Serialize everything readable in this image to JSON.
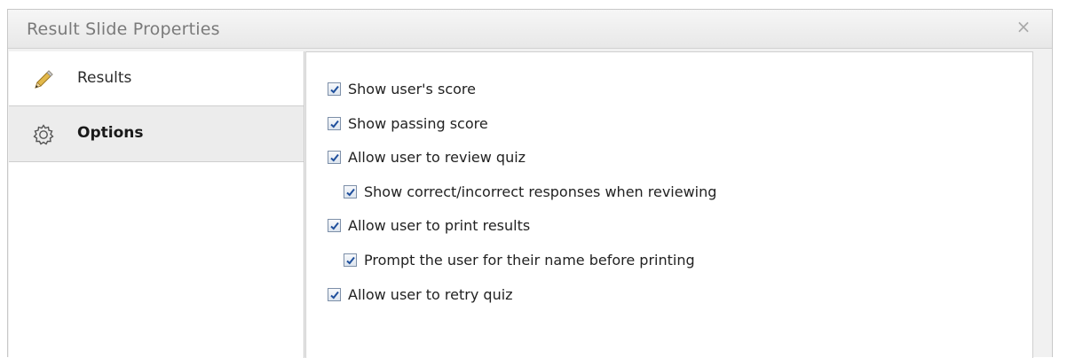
{
  "dialog": {
    "title": "Result Slide Properties",
    "close_glyph": "×"
  },
  "sidebar": {
    "items": [
      {
        "label": "Results",
        "icon": "pencil-icon",
        "selected": false
      },
      {
        "label": "Options",
        "icon": "gear-icon",
        "selected": true
      }
    ]
  },
  "options": [
    {
      "label": "Show user's score",
      "checked": true,
      "indent": 0
    },
    {
      "label": "Show passing score",
      "checked": true,
      "indent": 0
    },
    {
      "label": "Allow user to review quiz",
      "checked": true,
      "indent": 0
    },
    {
      "label": "Show correct/incorrect responses when reviewing",
      "checked": true,
      "indent": 1
    },
    {
      "label": "Allow user to print results",
      "checked": true,
      "indent": 0
    },
    {
      "label": "Prompt the user for their name before printing",
      "checked": true,
      "indent": 1
    },
    {
      "label": "Allow user to retry quiz",
      "checked": true,
      "indent": 0
    }
  ],
  "colors": {
    "checkmark": "#1f4f9c",
    "title_text": "#7a7a7a"
  }
}
